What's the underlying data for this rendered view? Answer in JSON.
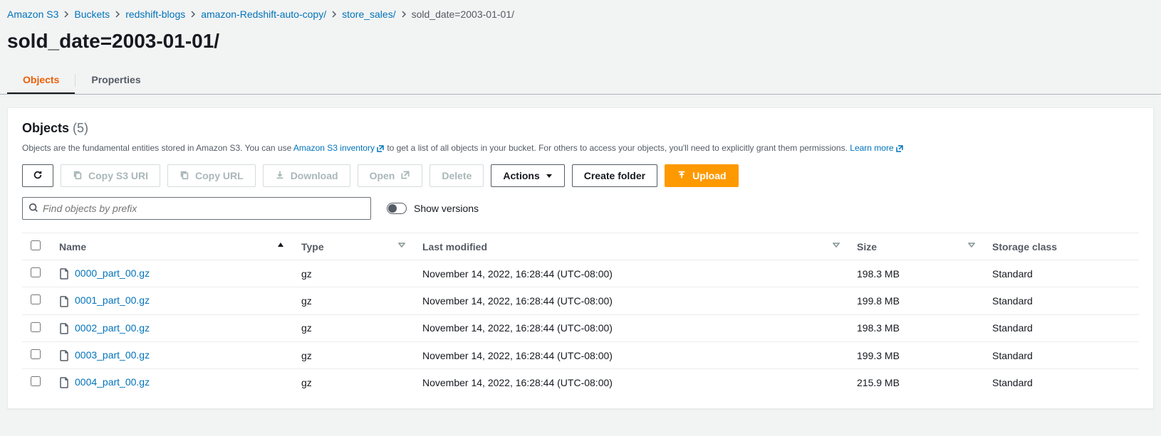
{
  "breadcrumbs": [
    {
      "label": "Amazon S3"
    },
    {
      "label": "Buckets"
    },
    {
      "label": "redshift-blogs"
    },
    {
      "label": "amazon-Redshift-auto-copy/"
    },
    {
      "label": "store_sales/"
    },
    {
      "label": "sold_date=2003-01-01/",
      "current": true
    }
  ],
  "page_title": "sold_date=2003-01-01/",
  "tabs": {
    "objects": "Objects",
    "properties": "Properties"
  },
  "panel": {
    "title": "Objects",
    "count": "(5)",
    "desc_pre": "Objects are the fundamental entities stored in Amazon S3. You can use ",
    "desc_link1": "Amazon S3 inventory",
    "desc_mid": " to get a list of all objects in your bucket. For others to access your objects, you'll need to explicitly grant them permissions. ",
    "desc_link2": "Learn more"
  },
  "toolbar": {
    "copy_s3_uri": "Copy S3 URI",
    "copy_url": "Copy URL",
    "download": "Download",
    "open": "Open",
    "delete": "Delete",
    "actions": "Actions",
    "create_folder": "Create folder",
    "upload": "Upload"
  },
  "filter": {
    "placeholder": "Find objects by prefix",
    "show_versions": "Show versions"
  },
  "columns": {
    "name": "Name",
    "type": "Type",
    "last_modified": "Last modified",
    "size": "Size",
    "storage_class": "Storage class"
  },
  "rows": [
    {
      "name": "0000_part_00.gz",
      "type": "gz",
      "modified": "November 14, 2022, 16:28:44 (UTC-08:00)",
      "size": "198.3 MB",
      "sc": "Standard"
    },
    {
      "name": "0001_part_00.gz",
      "type": "gz",
      "modified": "November 14, 2022, 16:28:44 (UTC-08:00)",
      "size": "199.8 MB",
      "sc": "Standard"
    },
    {
      "name": "0002_part_00.gz",
      "type": "gz",
      "modified": "November 14, 2022, 16:28:44 (UTC-08:00)",
      "size": "198.3 MB",
      "sc": "Standard"
    },
    {
      "name": "0003_part_00.gz",
      "type": "gz",
      "modified": "November 14, 2022, 16:28:44 (UTC-08:00)",
      "size": "199.3 MB",
      "sc": "Standard"
    },
    {
      "name": "0004_part_00.gz",
      "type": "gz",
      "modified": "November 14, 2022, 16:28:44 (UTC-08:00)",
      "size": "215.9 MB",
      "sc": "Standard"
    }
  ]
}
